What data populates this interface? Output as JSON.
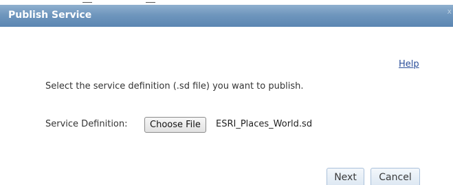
{
  "dialog": {
    "title": "Publish Service",
    "close_label": "x"
  },
  "help": {
    "label": "Help"
  },
  "instruction": {
    "text": "Select the service definition (.sd file) you want to publish."
  },
  "service_definition": {
    "label": "Service Definition:",
    "button_label": "Choose File",
    "selected_file": "ESRI_Places_World.sd"
  },
  "buttons": {
    "next": "Next",
    "cancel": "Cancel"
  },
  "colors": {
    "titlebar": "#6f96bd",
    "link": "#2a4e9a",
    "button_border": "#a9c0da"
  }
}
